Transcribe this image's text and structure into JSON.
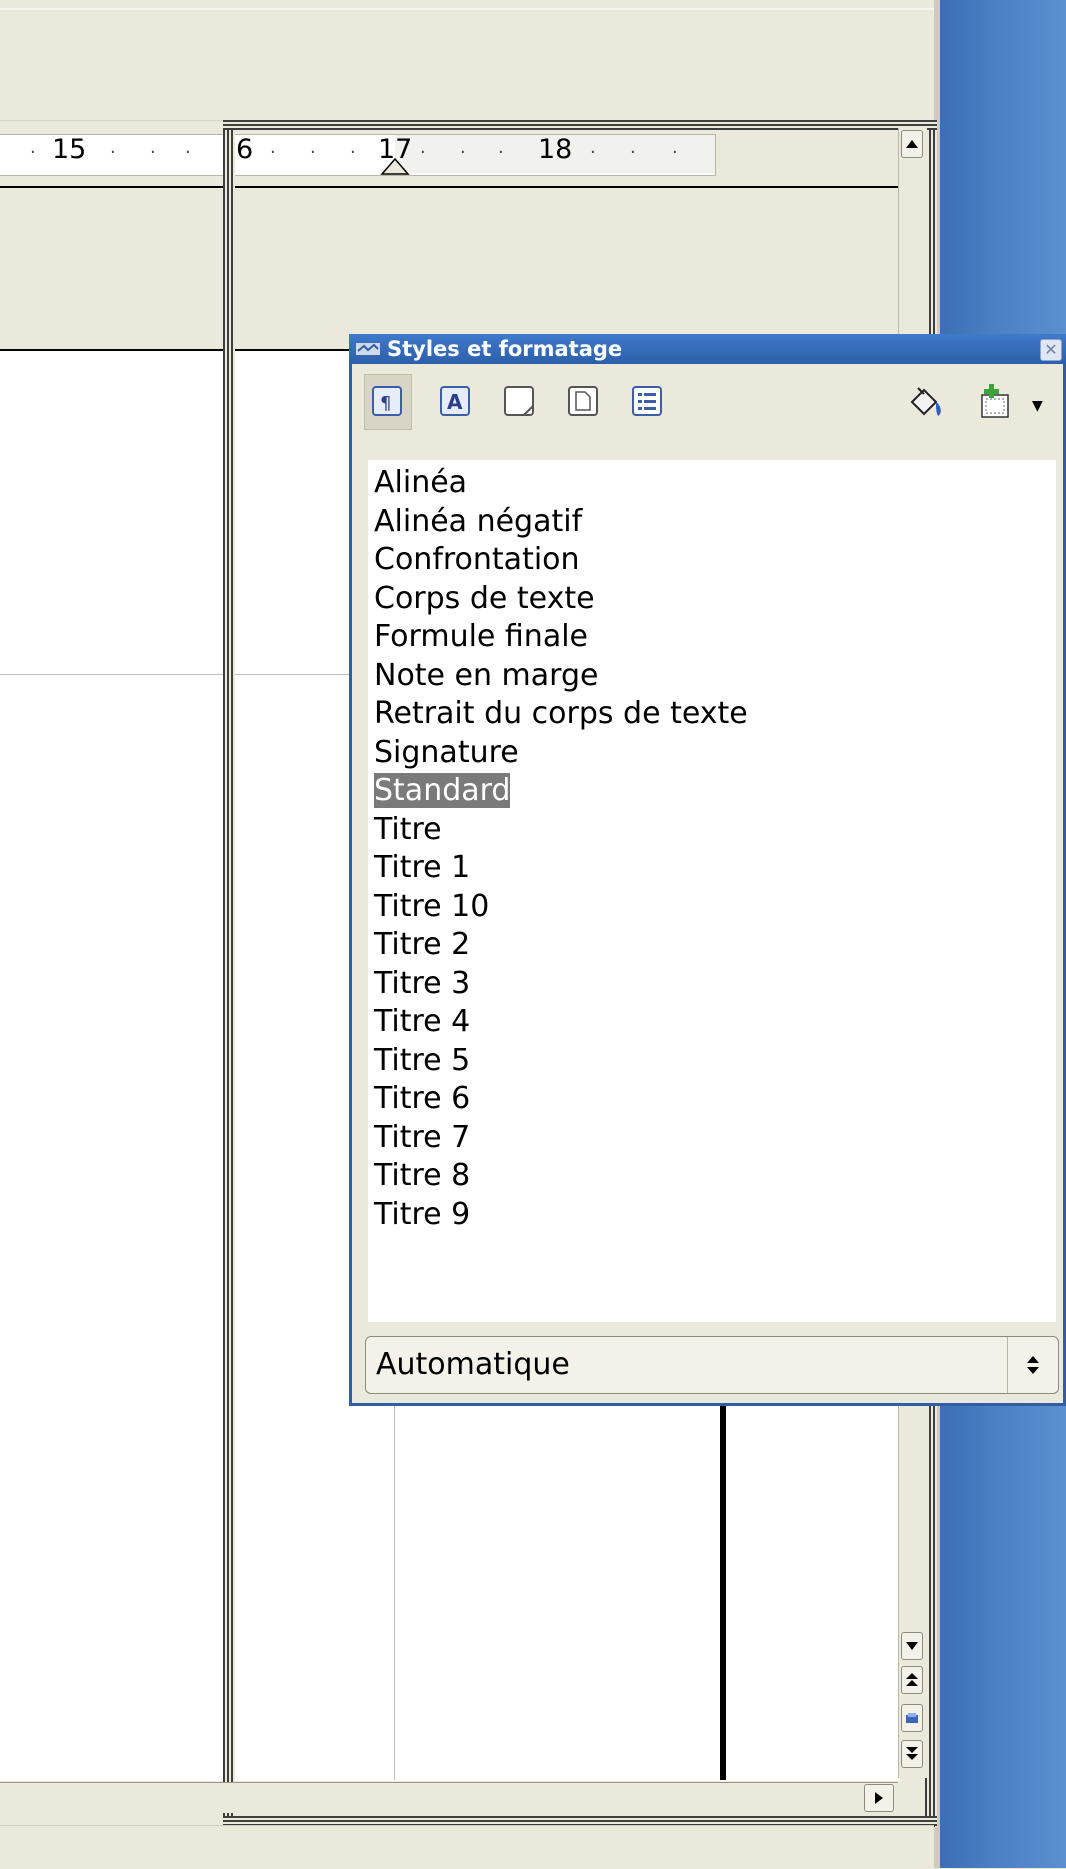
{
  "ruler": {
    "labels": [
      "15",
      "6",
      "17",
      "18"
    ],
    "leading_dot": "·"
  },
  "styles_window": {
    "title": "Styles et formatage",
    "toolbar": [
      {
        "name": "paragraph-styles",
        "glyph": "¶",
        "active": true
      },
      {
        "name": "character-styles",
        "glyph": "A",
        "active": false
      },
      {
        "name": "frame-styles",
        "glyph": "",
        "active": false
      },
      {
        "name": "page-styles",
        "glyph": "",
        "active": false
      },
      {
        "name": "list-styles",
        "glyph": "",
        "active": false
      }
    ],
    "styles": [
      "Alinéa",
      "Alinéa négatif",
      "Confrontation",
      "Corps de texte",
      "Formule finale",
      "Note en marge",
      "Retrait du corps de texte",
      "Signature",
      "Standard",
      "Titre",
      "Titre 1",
      "Titre 10",
      "Titre 2",
      "Titre 3",
      "Titre 4",
      "Titre 5",
      "Titre 6",
      "Titre 7",
      "Titre 8",
      "Titre 9"
    ],
    "selected_style": "Standard",
    "filter": "Automatique"
  },
  "colors": {
    "titlebar": "#2d5fa9",
    "desktop": "#4a7fc3",
    "selection": "#7a7a7a"
  }
}
